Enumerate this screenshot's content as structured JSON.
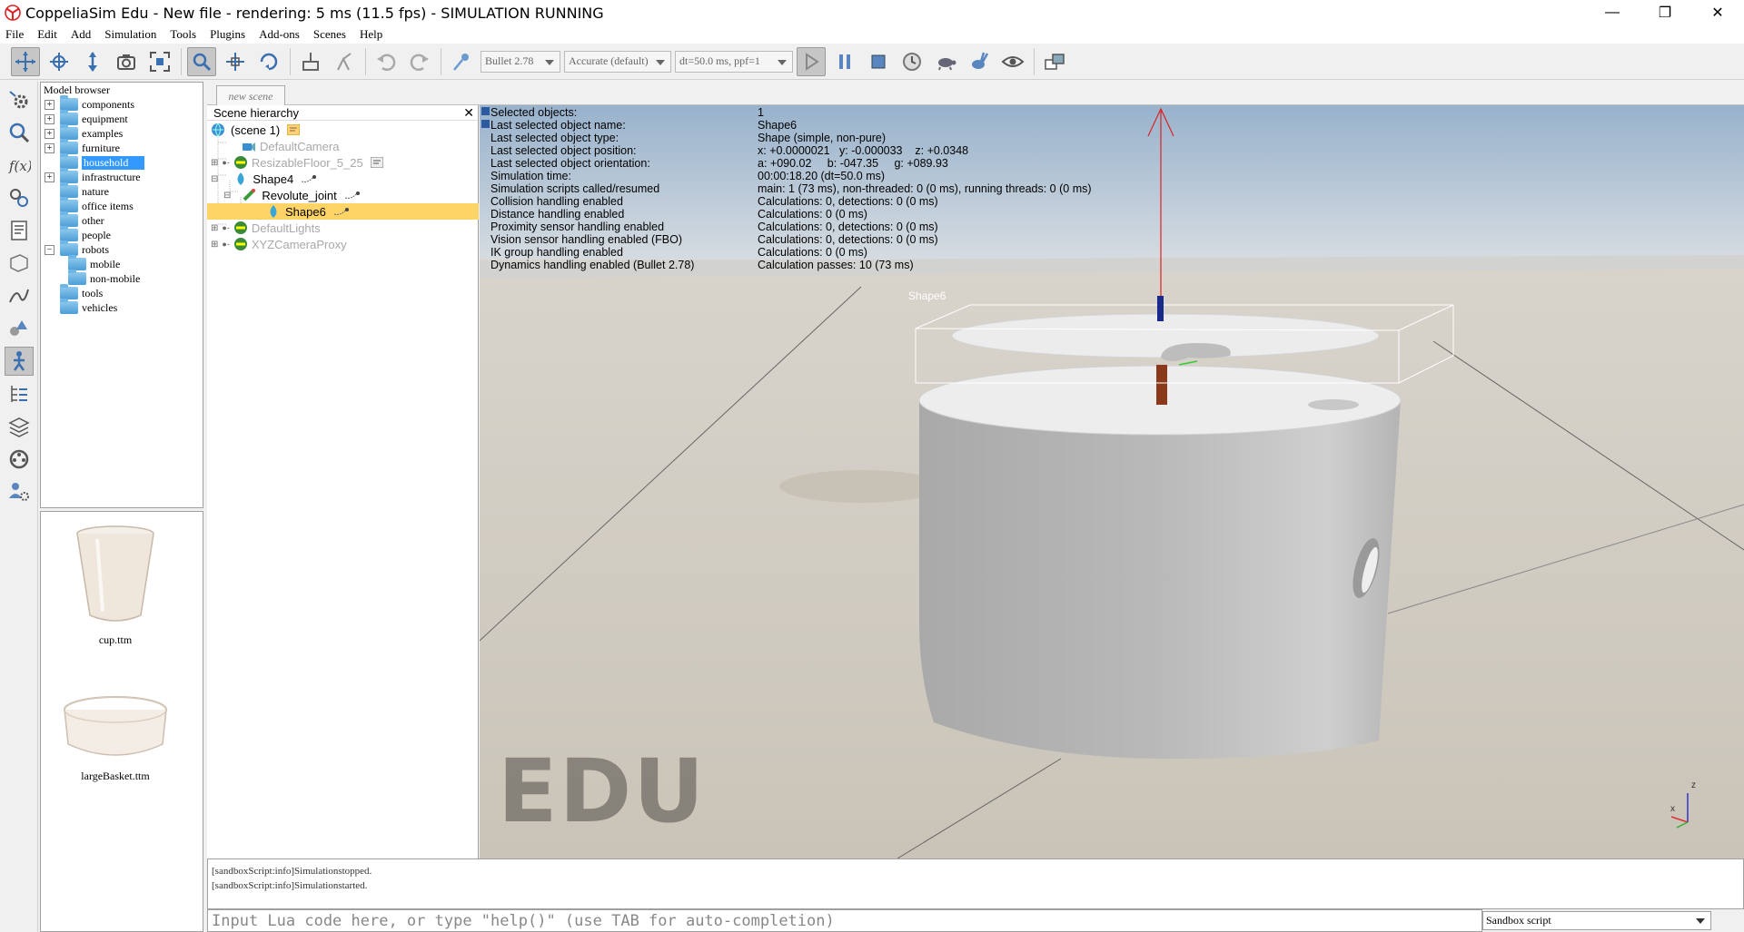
{
  "window": {
    "title": "CoppeliaSim Edu - New file - rendering: 5 ms (11.5 fps) - SIMULATION RUNNING",
    "minimize": "—",
    "restore": "❐",
    "close": "✕"
  },
  "menu": [
    "File",
    "Edit",
    "Add",
    "Simulation",
    "Tools",
    "Plugins",
    "Add-ons",
    "Scenes",
    "Help"
  ],
  "toolbar": {
    "engine": "Bullet 2.78",
    "accuracy": "Accurate (default)",
    "timestep": "dt=50.0 ms, ppf=1"
  },
  "model_browser": {
    "title": "Model browser",
    "items": [
      {
        "label": "components",
        "expandable": true
      },
      {
        "label": "equipment",
        "expandable": true
      },
      {
        "label": "examples",
        "expandable": true
      },
      {
        "label": "furniture",
        "expandable": true
      },
      {
        "label": "household",
        "expandable": false,
        "selected": true
      },
      {
        "label": "infrastructure",
        "expandable": true
      },
      {
        "label": "nature",
        "expandable": false
      },
      {
        "label": "office items",
        "expandable": false
      },
      {
        "label": "other",
        "expandable": false
      },
      {
        "label": "people",
        "expandable": false
      },
      {
        "label": "robots",
        "expandable": true,
        "expanded": true
      },
      {
        "label": "mobile",
        "expandable": false,
        "child": true
      },
      {
        "label": "non-mobile",
        "expandable": false,
        "child": true
      },
      {
        "label": "tools",
        "expandable": false
      },
      {
        "label": "vehicles",
        "expandable": false
      }
    ],
    "thumbnails": [
      "cup.ttm",
      "largeBasket.ttm"
    ]
  },
  "scene_tab": "new scene",
  "hierarchy": {
    "title": "Scene hierarchy",
    "close": "✕",
    "rows": [
      {
        "label": "(scene 1)",
        "depth": 0,
        "disabled": false
      },
      {
        "label": "DefaultCamera",
        "depth": 1,
        "disabled": true
      },
      {
        "label": "ResizableFloor_5_25",
        "depth": 1,
        "disabled": true
      },
      {
        "label": "Shape4",
        "depth": 1,
        "disabled": false
      },
      {
        "label": "Revolute_joint",
        "depth": 2,
        "disabled": false
      },
      {
        "label": "Shape6",
        "depth": 3,
        "disabled": false,
        "selected": true
      },
      {
        "label": "DefaultLights",
        "depth": 1,
        "disabled": true
      },
      {
        "label": "XYZCameraProxy",
        "depth": 1,
        "disabled": true
      }
    ]
  },
  "info": [
    [
      "Selected objects:",
      "1"
    ],
    [
      "Last selected object name:",
      "Shape6"
    ],
    [
      "Last selected object type:",
      "Shape (simple, non-pure)"
    ],
    [
      "Last selected object position:",
      "x: +0.0000021   y: -0.000033    z: +0.0348"
    ],
    [
      "Last selected object orientation:",
      "a: +090.02     b: -047.35     g: +089.93"
    ],
    [
      "Simulation time:",
      "00:00:18.20 (dt=50.0 ms)"
    ],
    [
      "Simulation scripts called/resumed",
      "main: 1 (73 ms), non-threaded: 0 (0 ms), running threads: 0 (0 ms)"
    ],
    [
      "Collision handling enabled",
      "Calculations: 0, detections: 0 (0 ms)"
    ],
    [
      "Distance handling enabled",
      "Calculations: 0 (0 ms)"
    ],
    [
      "Proximity sensor handling enabled",
      "Calculations: 0, detections: 0 (0 ms)"
    ],
    [
      "Vision sensor handling enabled (FBO)",
      "Calculations: 0, detections: 0 (0 ms)"
    ],
    [
      "IK group handling enabled",
      "Calculations: 0 (0 ms)"
    ],
    [
      "Dynamics handling enabled (Bullet 2.78)",
      "Calculation passes: 10 (73 ms)"
    ]
  ],
  "viewport": {
    "object_label": "Shape6",
    "watermark": "EDU",
    "axis_x": "x",
    "axis_z": "z"
  },
  "console": {
    "lines": [
      "[sandboxScript:info]Simulationstopped.",
      "[sandboxScript:info]Simulationstarted."
    ],
    "placeholder": "Input Lua code here, or type \"help()\" (use TAB for auto-completion)",
    "script_selector": "Sandbox script"
  }
}
